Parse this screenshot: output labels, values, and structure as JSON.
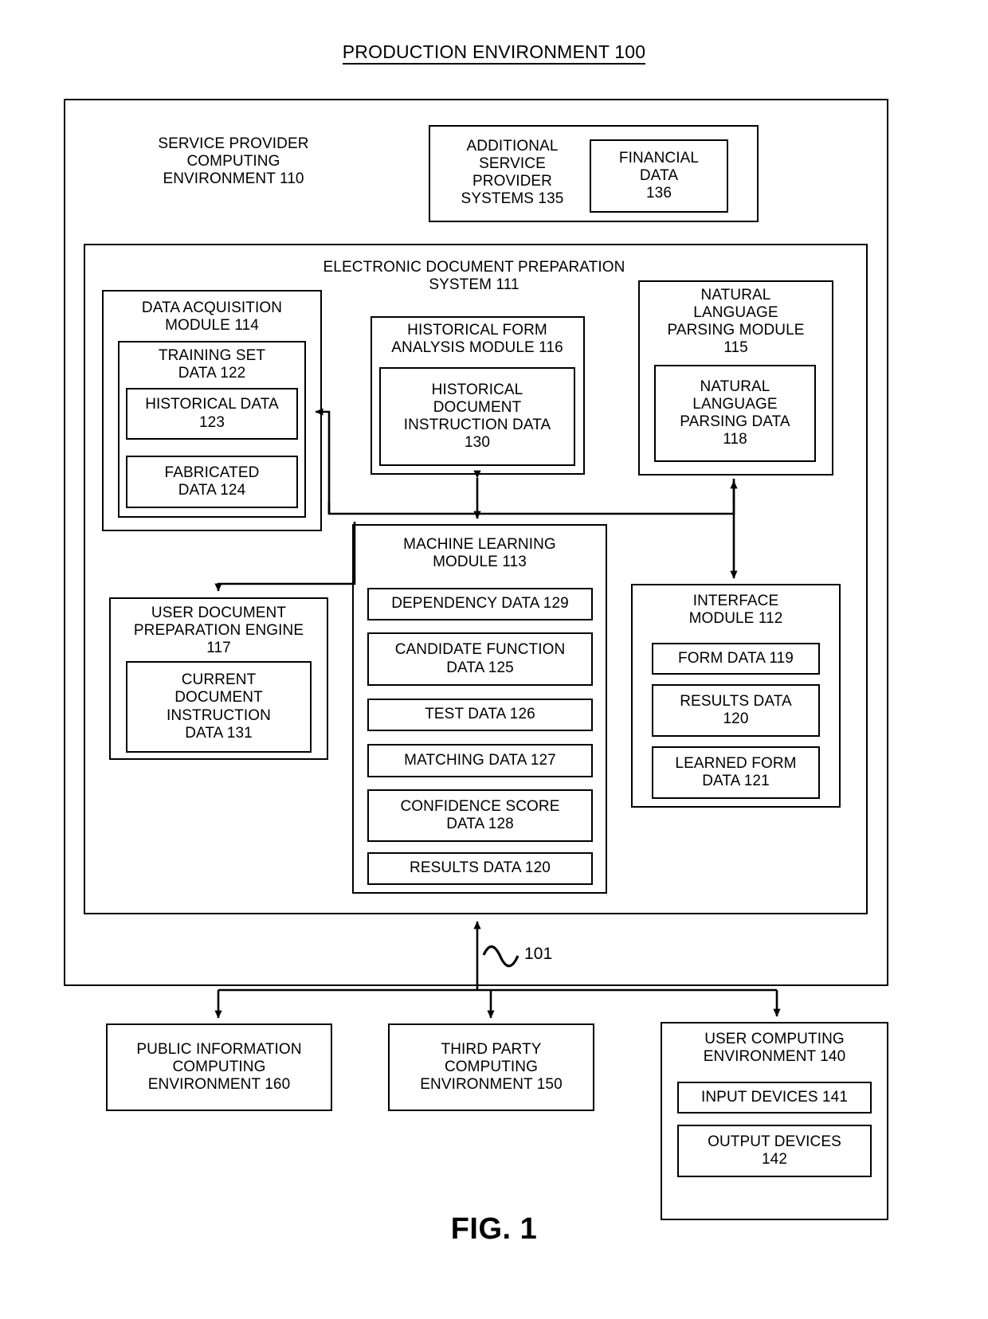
{
  "figure": {
    "title": "PRODUCTION ENVIRONMENT 100",
    "caption": "FIG. 1",
    "network_label": "101"
  },
  "service_provider": {
    "label": "SERVICE PROVIDER\nCOMPUTING\nENVIRONMENT 110"
  },
  "additional_systems": {
    "label": "ADDITIONAL\nSERVICE\nPROVIDER\nSYSTEMS 135",
    "financial_data": "FINANCIAL\nDATA\n136"
  },
  "edps": {
    "title": "ELECTRONIC DOCUMENT PREPARATION\nSYSTEM  111"
  },
  "data_acquisition": {
    "label": "DATA ACQUISITION\nMODULE 114",
    "training_set": "TRAINING SET\nDATA 122",
    "historical_data": "HISTORICAL DATA\n123",
    "fabricated_data": "FABRICATED\nDATA 124"
  },
  "historical_form_analysis": {
    "label": "HISTORICAL FORM\nANALYSIS MODULE 116",
    "instruction_data": "HISTORICAL\nDOCUMENT\nINSTRUCTION DATA\n130"
  },
  "nlp_module": {
    "label": "NATURAL\nLANGUAGE\nPARSING MODULE\n115",
    "parsing_data": "NATURAL\nLANGUAGE\nPARSING DATA\n118"
  },
  "user_doc_engine": {
    "label": "USER DOCUMENT\nPREPARATION  ENGINE\n117",
    "current_instruction_data": "CURRENT\nDOCUMENT\nINSTRUCTION\nDATA 131"
  },
  "ml_module": {
    "label": "MACHINE LEARNING\nMODULE 113",
    "items": [
      "DEPENDENCY DATA 129",
      "CANDIDATE FUNCTION\nDATA 125",
      "TEST DATA 126",
      "MATCHING DATA 127",
      "CONFIDENCE SCORE\nDATA 128",
      "RESULTS DATA 120"
    ]
  },
  "interface_module": {
    "label": "INTERFACE\nMODULE 112",
    "items": [
      "FORM DATA 119",
      "RESULTS DATA\n120",
      "LEARNED FORM\nDATA 121"
    ]
  },
  "public_info": {
    "label": "PUBLIC INFORMATION\nCOMPUTING\nENVIRONMENT 160"
  },
  "third_party": {
    "label": "THIRD PARTY\nCOMPUTING\nENVIRONMENT 150"
  },
  "user_computing": {
    "label": "USER COMPUTING\nENVIRONMENT 140",
    "input_devices": "INPUT DEVICES 141",
    "output_devices": "OUTPUT DEVICES\n142"
  }
}
